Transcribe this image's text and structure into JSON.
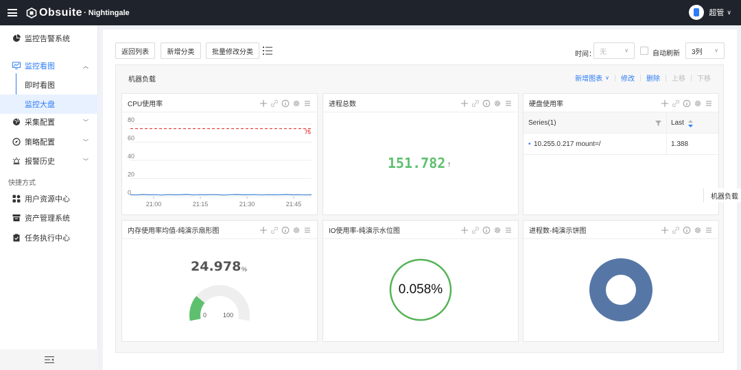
{
  "header": {
    "brand": "Obsuite",
    "brand_suffix": "· Nightingale",
    "user": "超管"
  },
  "sidebar": {
    "items": [
      {
        "label": "监控告警系统"
      },
      {
        "label": "监控看图"
      },
      {
        "label": "即时看图"
      },
      {
        "label": "监控大盘"
      },
      {
        "label": "采集配置"
      },
      {
        "label": "策略配置"
      },
      {
        "label": "报警历史"
      }
    ],
    "section": "快捷方式",
    "shortcuts": [
      {
        "label": "用户资源中心"
      },
      {
        "label": "资产管理系统"
      },
      {
        "label": "任务执行中心"
      }
    ]
  },
  "toolbar": {
    "back": "返回列表",
    "add_category": "新增分类",
    "batch_edit": "批量修改分类",
    "time_label": "时间：",
    "time_value": "无",
    "auto_refresh": "自动刷新",
    "columns": "3列"
  },
  "group": {
    "title": "机器负载",
    "actions": {
      "add_chart": "新增图表",
      "edit": "修改",
      "delete": "删除",
      "move_up": "上移",
      "move_down": "下移"
    }
  },
  "panels": {
    "cpu": {
      "title": "CPU使用率",
      "chart_data": {
        "type": "line",
        "x": [
          "21:00",
          "21:15",
          "21:30",
          "21:45"
        ],
        "yticks": [
          0,
          20,
          40,
          60,
          80
        ],
        "ylim": [
          0,
          80
        ],
        "threshold": 75,
        "threshold_label": "75",
        "series_values": [
          2.1,
          1.9,
          2.4,
          2.0,
          2.2,
          1.8,
          2.3,
          2.0,
          2.1,
          2.5,
          1.9,
          2.2,
          2.0,
          2.3,
          2.1,
          1.8,
          2.2,
          2.4,
          2.0,
          2.1,
          2.3,
          1.9,
          2.2,
          2.0,
          2.1,
          2.4,
          2.0,
          2.2,
          1.9,
          2.1
        ],
        "grid": true,
        "colors": {
          "line": "#4b8bd6",
          "threshold": "#e64545"
        }
      }
    },
    "process_total": {
      "title": "进程总数",
      "value": "151.782",
      "arrow": "↑"
    },
    "disk": {
      "title": "硬盘使用率",
      "columns": [
        "Series(1)",
        "Last"
      ],
      "rows": [
        {
          "series": "10.255.0.217 mount=/",
          "last": "1.388"
        }
      ]
    },
    "memory": {
      "title": "内存使用率均值-纯演示扇形图",
      "value": "24.978",
      "unit": "%",
      "fraction": 0.24978,
      "min": "0",
      "max": "100"
    },
    "io": {
      "title": "IO使用率-纯演示水位图",
      "value": "0.058%"
    },
    "proc_pie": {
      "title": "进程数-纯演示饼图"
    }
  },
  "side_tab": "机器负载",
  "colors": {
    "accent": "#2f7df6",
    "green": "#5ec06f",
    "donut": "#5677a6"
  }
}
